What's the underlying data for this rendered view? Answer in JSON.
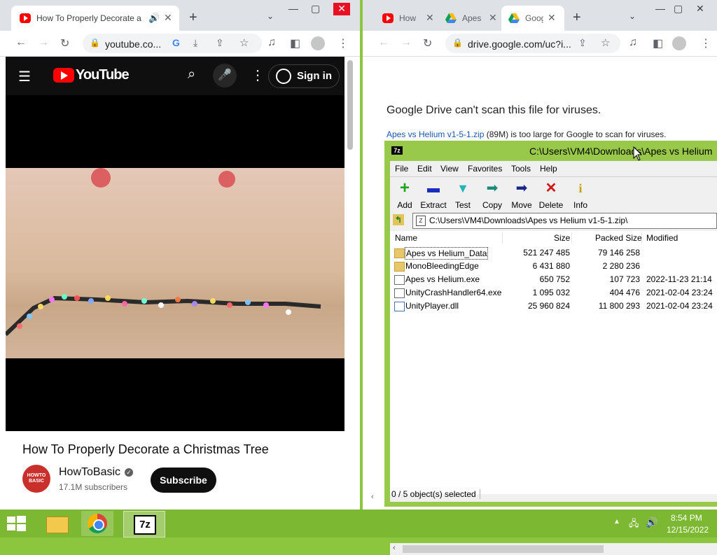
{
  "left_browser": {
    "tab": {
      "title": "How To Properly Decorate a",
      "icon": "youtube-favicon"
    },
    "url": "youtube.co...",
    "youtube": {
      "logo_text": "YouTube",
      "sign_in": "Sign in",
      "video_title": "How To Properly Decorate a Christmas Tree",
      "channel_name": "HowToBasic",
      "avatar_text": "HOWTO BASIC",
      "subscribers": "17.1M subscribers",
      "subscribe": "Subscribe"
    }
  },
  "right_browser": {
    "tabs": [
      {
        "title": "How",
        "icon": "youtube-favicon"
      },
      {
        "title": "Apes",
        "icon": "drive-favicon"
      },
      {
        "title": "Goog",
        "icon": "drive-favicon",
        "active": true
      }
    ],
    "url": "drive.google.com/uc?i...",
    "drive": {
      "heading": "Google Drive can't scan this file for viruses.",
      "file_link": "Apes vs Helium v1-5-1.zip",
      "message_rest": " (89M) is too large for Google to scan for viruses."
    }
  },
  "sevenzip": {
    "title": "C:\\Users\\VM4\\Downloads\\Apes vs Helium",
    "menu": [
      "File",
      "Edit",
      "View",
      "Favorites",
      "Tools",
      "Help"
    ],
    "toolbar": [
      "Add",
      "Extract",
      "Test",
      "Copy",
      "Move",
      "Delete",
      "Info"
    ],
    "path": "C:\\Users\\VM4\\Downloads\\Apes vs Helium v1-5-1.zip\\",
    "columns": {
      "name": "Name",
      "size": "Size",
      "packed": "Packed Size",
      "modified": "Modified"
    },
    "rows": [
      {
        "name": "Apes vs Helium_Data",
        "type": "folder",
        "size": "521 247 485",
        "packed": "79 146 258",
        "modified": ""
      },
      {
        "name": "MonoBleedingEdge",
        "type": "folder",
        "size": "6 431 880",
        "packed": "2 280 236",
        "modified": ""
      },
      {
        "name": "Apes vs Helium.exe",
        "type": "exe",
        "size": "650 752",
        "packed": "107 723",
        "modified": "2022-11-23 21:14"
      },
      {
        "name": "UnityCrashHandler64.exe",
        "type": "exe",
        "size": "1 095 032",
        "packed": "404 476",
        "modified": "2021-02-04 23:24"
      },
      {
        "name": "UnityPlayer.dll",
        "type": "dll",
        "size": "25 960 824",
        "packed": "11 800 293",
        "modified": "2021-02-04 23:24"
      }
    ],
    "status": "0 / 5 object(s) selected"
  },
  "taskbar": {
    "time": "8:54 PM",
    "date": "12/15/2022",
    "apps": [
      "file-explorer",
      "chrome",
      "7-zip"
    ],
    "sevenzip_label": "7z"
  }
}
